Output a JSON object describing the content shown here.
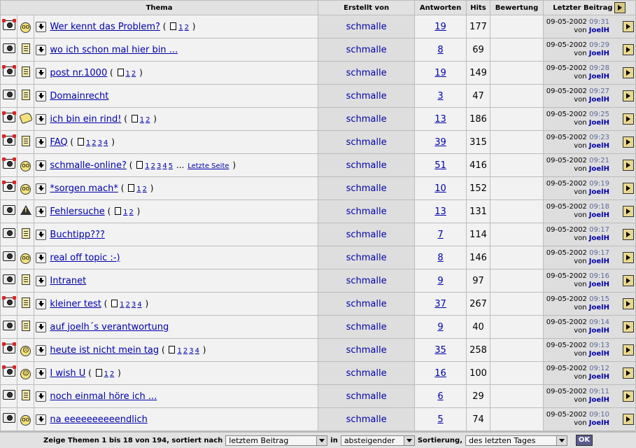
{
  "headers": {
    "thema": "Thema",
    "erstellt": "Erstellt von",
    "antworten": "Antworten",
    "hits": "Hits",
    "bewertung": "Bewertung",
    "letzter": "Letzter Beitrag"
  },
  "rows": [
    {
      "icon": "folder-hot-icon",
      "icon2": "face-icon",
      "face": "oo",
      "title": "Wer kennt das Problem?",
      "pages": [
        "1",
        "2"
      ],
      "author": "schmalle",
      "answers": "19",
      "hits": "177",
      "date": "09-05-2002",
      "time": "09:31",
      "by_prefix": "von",
      "by": "JoelH"
    },
    {
      "icon": "folder-icon",
      "icon2": "note-icon",
      "title": "wo ich schon mal hier bin ...",
      "pages": [],
      "author": "schmalle",
      "answers": "8",
      "hits": "69",
      "date": "09-05-2002",
      "time": "09:29",
      "by_prefix": "von",
      "by": "JoelH"
    },
    {
      "icon": "folder-hot-icon",
      "icon2": "note-icon",
      "title": "post nr.1000",
      "pages": [
        "1",
        "2"
      ],
      "author": "schmalle",
      "answers": "19",
      "hits": "149",
      "date": "09-05-2002",
      "time": "09:28",
      "by_prefix": "von",
      "by": "JoelH"
    },
    {
      "icon": "folder-icon",
      "icon2": "note-icon",
      "title": "Domainrecht",
      "pages": [],
      "author": "schmalle",
      "answers": "3",
      "hits": "47",
      "date": "09-05-2002",
      "time": "09:27",
      "by_prefix": "von",
      "by": "JoelH"
    },
    {
      "icon": "folder-hot-icon",
      "icon2": "hand-icon",
      "title": "ich bin ein rind!",
      "pages": [
        "1",
        "2"
      ],
      "author": "schmalle",
      "answers": "13",
      "hits": "186",
      "date": "09-05-2002",
      "time": "09:25",
      "by_prefix": "von",
      "by": "JoelH"
    },
    {
      "icon": "folder-hot-icon",
      "icon2": "note-icon",
      "title": "FAQ",
      "pages": [
        "1",
        "2",
        "3",
        "4"
      ],
      "author": "schmalle",
      "answers": "39",
      "hits": "315",
      "date": "09-05-2002",
      "time": "09:23",
      "by_prefix": "von",
      "by": "JoelH"
    },
    {
      "icon": "folder-hot-icon",
      "icon2": "face-icon",
      "face": "oo",
      "title": "schmalle-online?",
      "pages": [
        "1",
        "2",
        "3",
        "4",
        "5"
      ],
      "ellipsis": "...",
      "last_page": "Letzte Seite",
      "author": "schmalle",
      "answers": "51",
      "hits": "416",
      "date": "09-05-2002",
      "time": "09:21",
      "by_prefix": "von",
      "by": "JoelH"
    },
    {
      "icon": "folder-hot-icon",
      "icon2": "face-icon",
      "face": "oo",
      "title": "*sorgen mach*",
      "pages": [
        "1",
        "2"
      ],
      "author": "schmalle",
      "answers": "10",
      "hits": "152",
      "date": "09-05-2002",
      "time": "09:19",
      "by_prefix": "von",
      "by": "JoelH"
    },
    {
      "icon": "folder-icon",
      "icon2": "warn-icon",
      "title": "Fehlersuche",
      "pages": [
        "1",
        "2"
      ],
      "author": "schmalle",
      "answers": "13",
      "hits": "131",
      "date": "09-05-2002",
      "time": "09:18",
      "by_prefix": "von",
      "by": "JoelH"
    },
    {
      "icon": "folder-icon",
      "icon2": "note-icon",
      "title": "Buchtipp???",
      "pages": [],
      "author": "schmalle",
      "answers": "7",
      "hits": "114",
      "date": "09-05-2002",
      "time": "09:17",
      "by_prefix": "von",
      "by": "JoelH"
    },
    {
      "icon": "folder-icon",
      "icon2": "face-icon",
      "face": "oo",
      "title": "real off topic :-)",
      "pages": [],
      "author": "schmalle",
      "answers": "8",
      "hits": "146",
      "date": "09-05-2002",
      "time": "09:17",
      "by_prefix": "von",
      "by": "JoelH"
    },
    {
      "icon": "folder-icon",
      "icon2": "note-icon",
      "title": "Intranet",
      "pages": [],
      "author": "schmalle",
      "answers": "9",
      "hits": "97",
      "date": "09-05-2002",
      "time": "09:16",
      "by_prefix": "von",
      "by": "JoelH"
    },
    {
      "icon": "folder-hot-icon",
      "icon2": "note-icon",
      "title": "kleiner test",
      "pages": [
        "1",
        "2",
        "3",
        "4"
      ],
      "author": "schmalle",
      "answers": "37",
      "hits": "267",
      "date": "09-05-2002",
      "time": "09:15",
      "by_prefix": "von",
      "by": "JoelH"
    },
    {
      "icon": "folder-icon",
      "icon2": "note-icon",
      "title": "auf joelh´s verantwortung",
      "pages": [],
      "author": "schmalle",
      "answers": "9",
      "hits": "40",
      "date": "09-05-2002",
      "time": "09:14",
      "by_prefix": "von",
      "by": "JoelH"
    },
    {
      "icon": "folder-hot-icon",
      "icon2": "face-icon",
      "face": "☹",
      "title": "heute ist nicht mein tag",
      "pages": [
        "1",
        "2",
        "3",
        "4"
      ],
      "author": "schmalle",
      "answers": "35",
      "hits": "258",
      "date": "09-05-2002",
      "time": "09:13",
      "by_prefix": "von",
      "by": "JoelH"
    },
    {
      "icon": "folder-hot-icon",
      "icon2": "face-icon",
      "face": "☺",
      "title": "I wish U",
      "pages": [
        "1",
        "2"
      ],
      "author": "schmalle",
      "answers": "16",
      "hits": "100",
      "date": "09-05-2002",
      "time": "09:12",
      "by_prefix": "von",
      "by": "JoelH"
    },
    {
      "icon": "folder-icon",
      "icon2": "note-icon",
      "title": "noch einmal höre ich ...",
      "pages": [],
      "author": "schmalle",
      "answers": "6",
      "hits": "29",
      "date": "09-05-2002",
      "time": "09:11",
      "by_prefix": "von",
      "by": "JoelH"
    },
    {
      "icon": "folder-icon",
      "icon2": "face-icon",
      "face": "oo",
      "title": "na eeeeeeeeeendlich",
      "pages": [],
      "author": "schmalle",
      "answers": "5",
      "hits": "74",
      "date": "09-05-2002",
      "time": "09:10",
      "by_prefix": "von",
      "by": "JoelH"
    }
  ],
  "footer": {
    "summary": "Zeige Themen 1 bis 18 von 194, sortiert nach",
    "sort_by": "letztem Beitrag",
    "in_label": "in",
    "order": "absteigender",
    "order_suffix": "Sortierung,",
    "range": "des letzten Tages",
    "ok": "OK"
  },
  "colors": {
    "link": "#0000aa",
    "time": "#5a6a9a",
    "header_bg": "#e2e2e2",
    "author_bg": "#dedede",
    "row_bg": "#f2f2f2"
  }
}
